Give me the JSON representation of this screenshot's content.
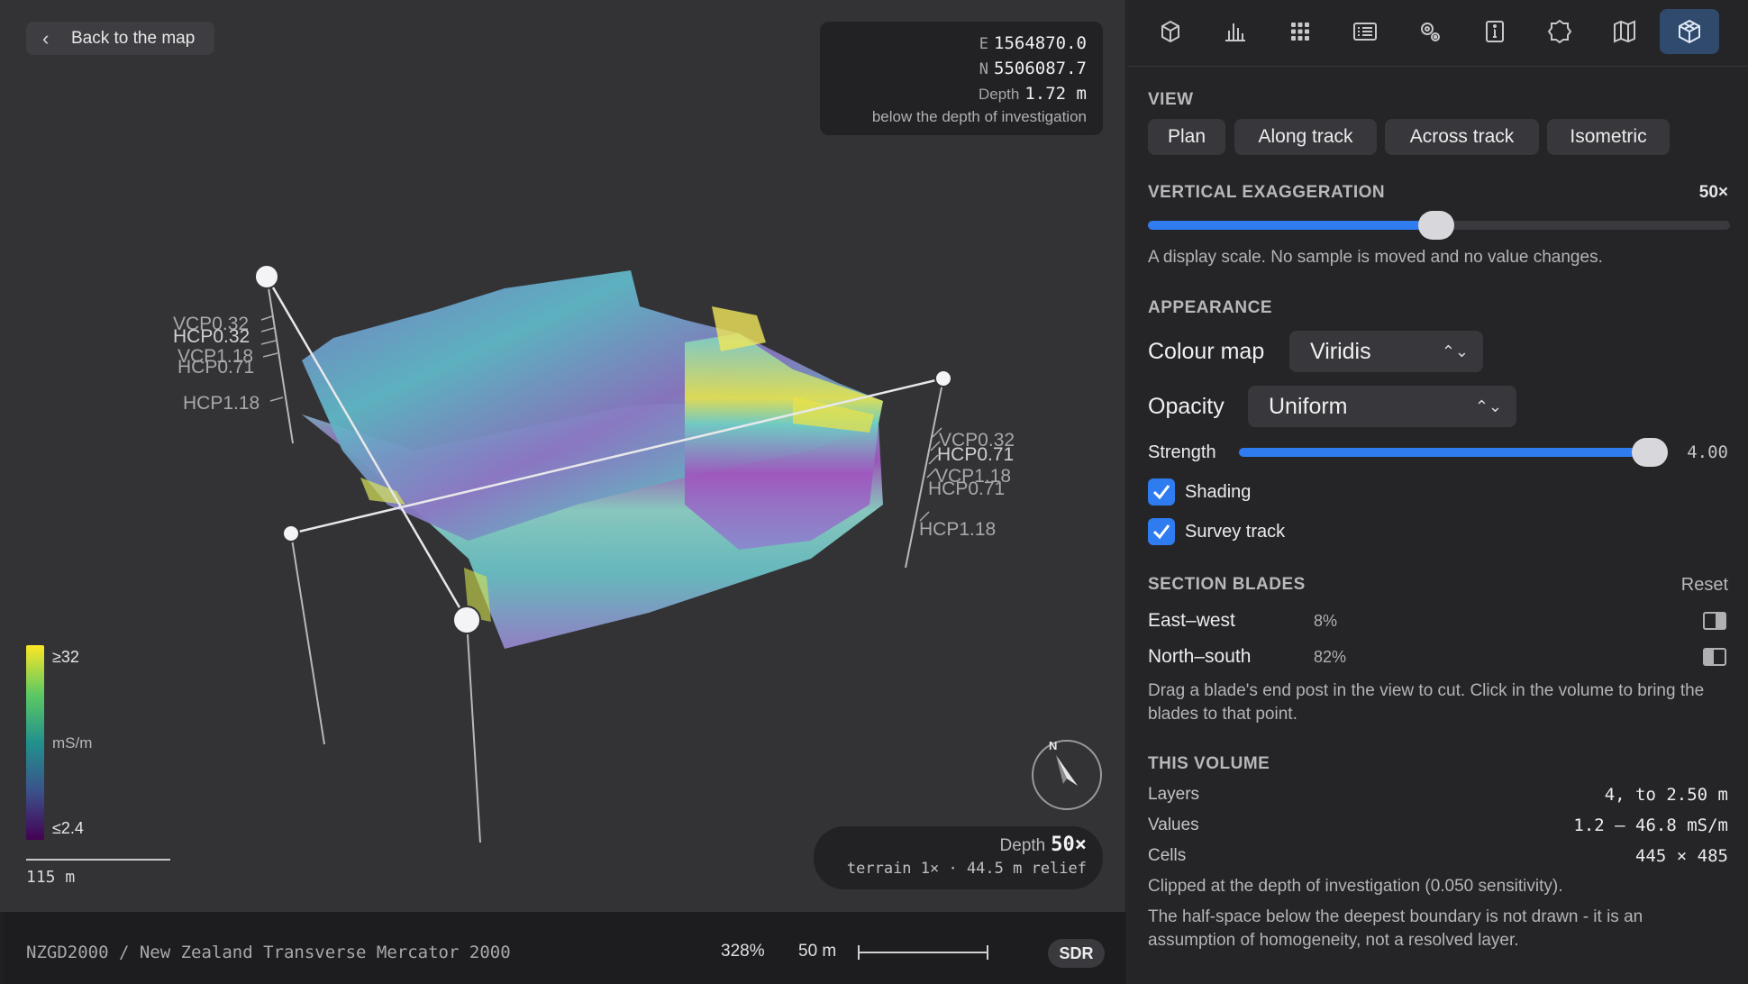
{
  "viewport": {
    "back_label": "Back to the map",
    "coords": {
      "e_label": "E",
      "e_value": "1564870.0",
      "n_label": "N",
      "n_value": "5506087.7",
      "depth_label": "Depth",
      "depth_value": "1.72 m",
      "note": "below the depth of investigation"
    },
    "colorbar": {
      "max": "≥32",
      "unit": "mS/m",
      "min": "≤2.4"
    },
    "scale": "115 m",
    "compass_label": "N",
    "depth_box": {
      "label": "Depth",
      "value": "50×",
      "sub": "terrain 1× · 44.5 m relief"
    },
    "posts_left": [
      "VCP0.32",
      "HCP0.32",
      "VCP1.18",
      "HCP0.71",
      "HCP1.18"
    ],
    "posts_right": [
      "VCP0.32",
      "HCP0.71",
      "VCP1.18",
      "HCP0.71",
      "HCP1.18"
    ]
  },
  "statusbar": {
    "crs": "NZGD2000 / New Zealand Transverse Mercator 2000",
    "zoom": "328%",
    "scale": "50 m",
    "sdr": "SDR"
  },
  "toolbar": {
    "icons": [
      "cube-outline-icon",
      "bar-chart-icon",
      "grid-icon",
      "list-icon",
      "settings-icon",
      "info-icon",
      "badge-icon",
      "map-icon",
      "cube-3d-icon"
    ],
    "active": "cube-3d-icon"
  },
  "panel": {
    "view": {
      "title": "VIEW",
      "buttons": [
        "Plan",
        "Along track",
        "Across track",
        "Isometric"
      ]
    },
    "vertical": {
      "title": "VERTICAL EXAGGERATION",
      "value": "50×",
      "fraction": 0.495,
      "help": "A display scale. No sample is moved and no value changes."
    },
    "appearance": {
      "title": "APPEARANCE",
      "colour_map_label": "Colour map",
      "colour_map_value": "Viridis",
      "opacity_label": "Opacity",
      "opacity_value": "Uniform",
      "strength_label": "Strength",
      "strength_value": "4.00",
      "strength_fraction": 0.97,
      "shading_label": "Shading",
      "survey_track_label": "Survey track"
    },
    "blades": {
      "title": "SECTION BLADES",
      "reset": "Reset",
      "items": [
        {
          "name": "East–west",
          "pct": "8%"
        },
        {
          "name": "North–south",
          "pct": "82%"
        }
      ],
      "help": "Drag a blade's end post in the view to cut. Click in the volume to bring the blades to that point."
    },
    "volume": {
      "title": "THIS VOLUME",
      "rows": [
        {
          "k": "Layers",
          "v": "4, to 2.50 m"
        },
        {
          "k": "Values",
          "v": "1.2 — 46.8 mS/m"
        },
        {
          "k": "Cells",
          "v": "445 × 485"
        }
      ],
      "note1": "Clipped at the depth of investigation (0.050 sensitivity).",
      "note2": "The half-space below the deepest boundary is not drawn - it is an assumption of homogeneity, not a resolved layer."
    }
  }
}
